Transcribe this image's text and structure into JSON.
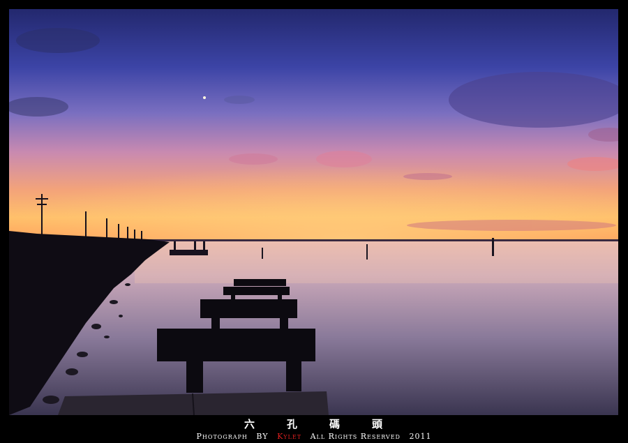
{
  "photo": {
    "subject": "pier-at-sunset",
    "palette": {
      "sky_top": "#2a2f7a",
      "sky_mid": "#5a5fb8",
      "sky_glow": "#f0a070",
      "horizon": "#ffb060",
      "water": "#b89aa8",
      "silhouette": "#0d0d14"
    }
  },
  "caption": {
    "title_chars": [
      "六",
      "孔",
      "碼",
      "頭"
    ],
    "credit_prefix": "Photograph",
    "credit_by": "BY",
    "credit_name": "Kylet",
    "credit_rights": "All Rights Reserved",
    "credit_year": "2011"
  }
}
